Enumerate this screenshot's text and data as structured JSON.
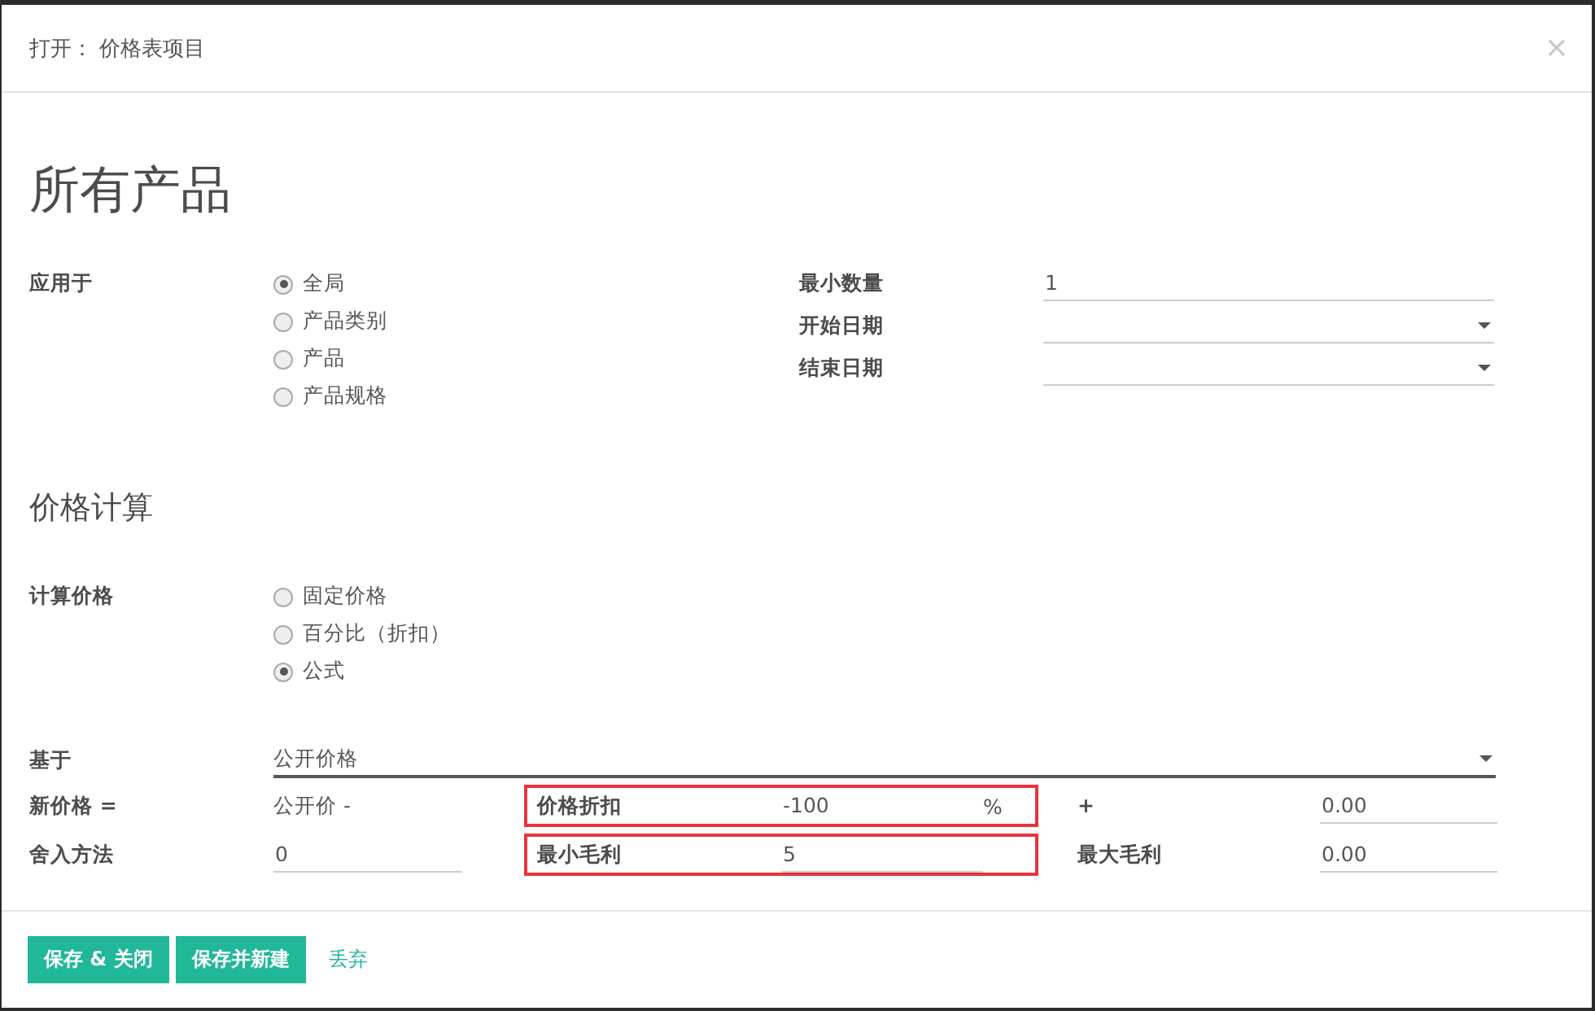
{
  "dialog": {
    "title": "打开： 价格表项目",
    "close": "×"
  },
  "heading": "所有产品",
  "apply_to": {
    "label": "应用于",
    "options": [
      {
        "label": "全局",
        "selected": true
      },
      {
        "label": "产品类别",
        "selected": false
      },
      {
        "label": "产品",
        "selected": false
      },
      {
        "label": "产品规格",
        "selected": false
      }
    ]
  },
  "right_fields": [
    {
      "label": "最小数量",
      "value": "1",
      "dropdown": false
    },
    {
      "label": "开始日期",
      "dropdown": true
    },
    {
      "label": "结束日期",
      "dropdown": true
    }
  ],
  "section_title": "价格计算",
  "compute_price": {
    "label": "计算价格",
    "options": [
      {
        "label": "固定价格",
        "selected": false
      },
      {
        "label": "百分比（折扣）",
        "selected": false
      },
      {
        "label": "公式",
        "selected": true
      }
    ]
  },
  "based_on": {
    "label": "基于",
    "value": "公开价格"
  },
  "formula_rows": [
    {
      "label": "新价格 =",
      "first": {
        "kind": "text",
        "value": "公开价 -"
      },
      "middle": {
        "label": "价格折扣",
        "value": "-100",
        "suffix": "%",
        "highlighted": true,
        "underline": false
      },
      "right_label": "+",
      "right_value": "0.00"
    },
    {
      "label": "舍入方法",
      "first": {
        "kind": "field",
        "value": "0"
      },
      "middle": {
        "label": "最小毛利",
        "value": "5",
        "highlighted": true,
        "underline": true
      },
      "right_label": "最大毛利",
      "right_value": "0.00"
    }
  ],
  "buttons": [
    {
      "label": "保存 & 关闭",
      "kind": "primary"
    },
    {
      "label": "保存并新建",
      "kind": "primary"
    },
    {
      "label": "丢弃",
      "kind": "link"
    }
  ]
}
